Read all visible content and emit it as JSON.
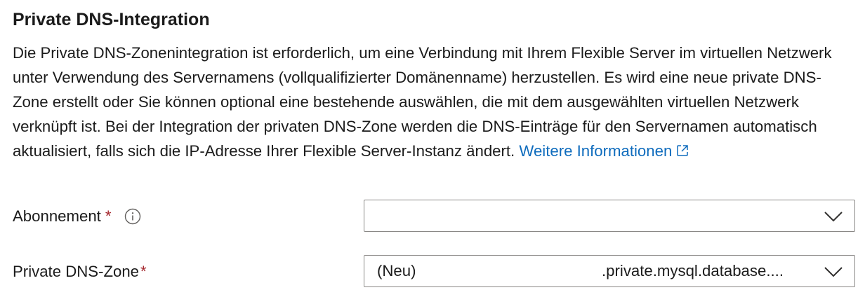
{
  "section": {
    "title": "Private DNS-Integration",
    "description": "Die Private DNS-Zonenintegration ist erforderlich, um eine Verbindung mit Ihrem Flexible Server im virtuellen Netzwerk unter Verwendung des Servernamens (vollqualifizierter Domänenname) herzustellen. Es wird eine neue private DNS-Zone erstellt oder Sie können optional eine bestehende auswählen, die mit dem ausgewählten virtuellen Netzwerk verknüpft ist. Bei der Integration der privaten DNS-Zone werden die DNS-Einträge für den Servernamen automatisch aktualisiert, falls sich die IP-Adresse Ihrer Flexible Server-Instanz ändert.",
    "learn_more_label": "Weitere Informationen",
    "learn_more_icon": "external-link-icon"
  },
  "fields": {
    "subscription": {
      "label": "Abonnement",
      "required_marker": "*",
      "info_icon": "info-icon",
      "value": ""
    },
    "dns_zone": {
      "label": "Private DNS-Zone",
      "required_marker": "*",
      "value_prefix": "(Neu)",
      "value": ".private.mysql.database...."
    }
  },
  "colors": {
    "link": "#0f6cbd",
    "required": "#a4262c",
    "border": "#8a8886",
    "text": "#1b1b1b"
  }
}
